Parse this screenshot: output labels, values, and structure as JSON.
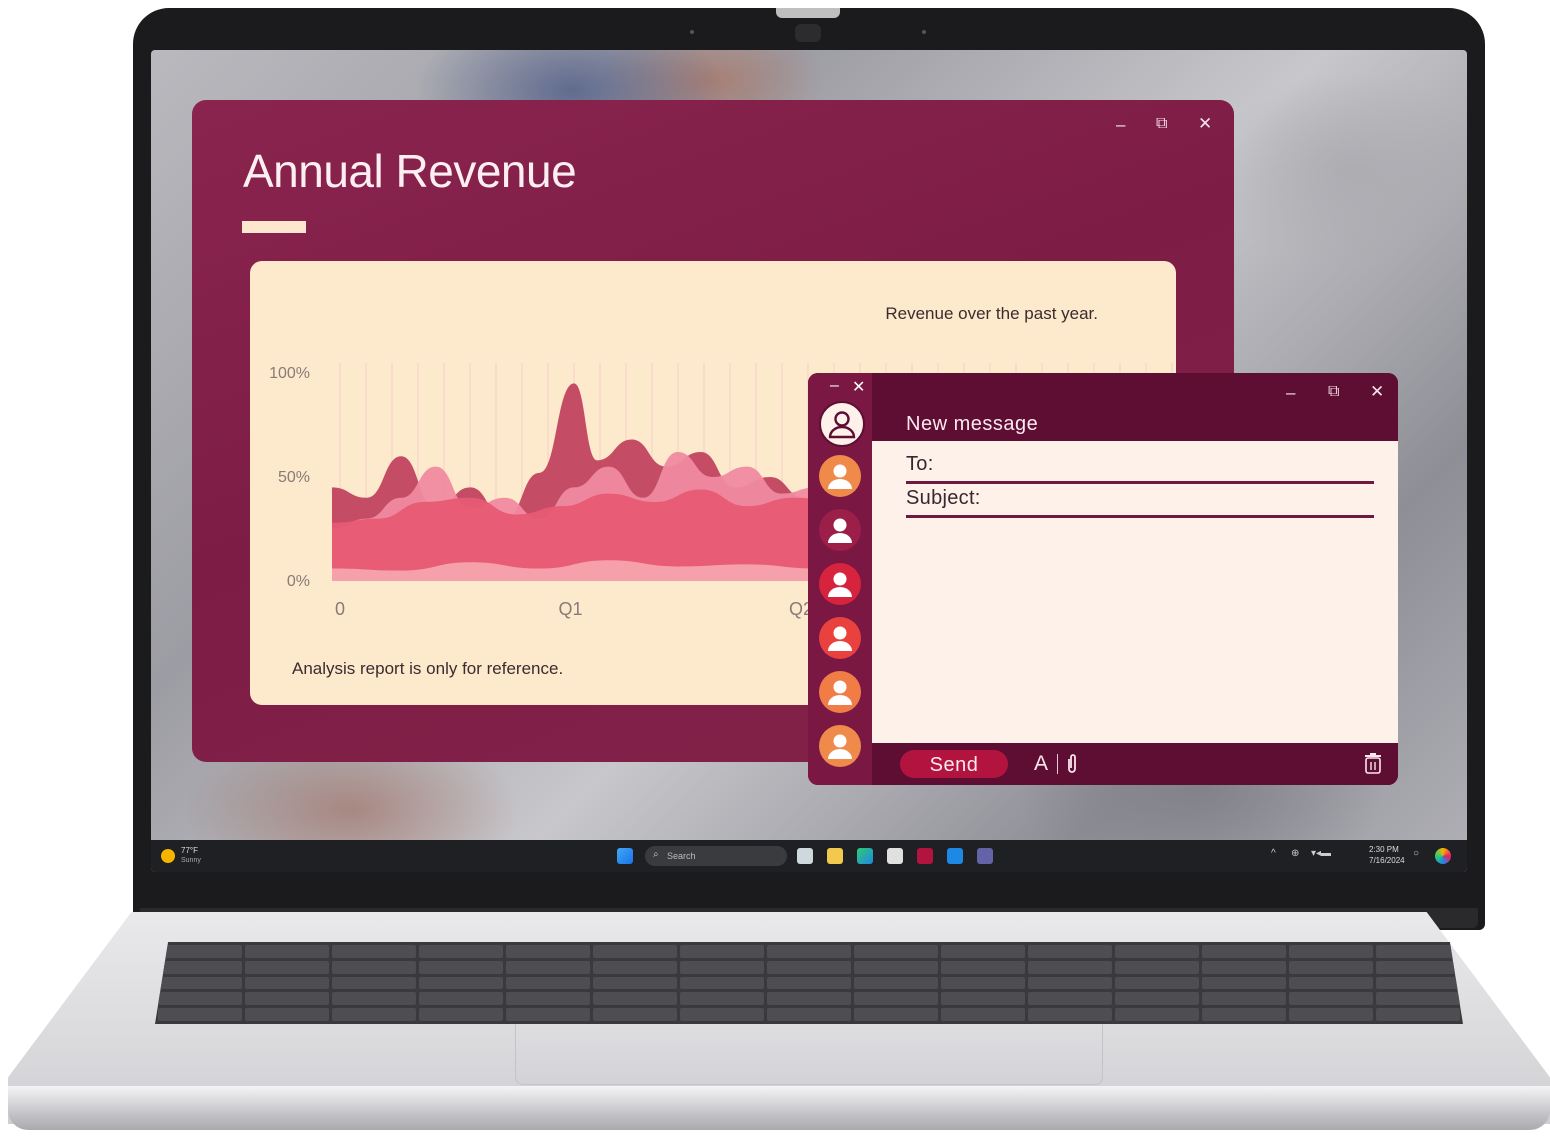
{
  "revenue_window": {
    "title": "Annual Revenue",
    "controls": {
      "minimize": "–",
      "maximize": "⧉",
      "close": "✕"
    }
  },
  "chart_data": {
    "type": "area",
    "title": "Revenue over the past year.",
    "footnote": "Analysis report is only for reference.",
    "yticks": [
      "100%",
      "50%",
      "0%"
    ],
    "xticks": [
      "0",
      "Q1",
      "Q2"
    ],
    "ylim": [
      0,
      100
    ],
    "xlim": [
      0,
      4
    ],
    "grid": true,
    "series": [
      {
        "color": "#c1455f",
        "x": [
          0,
          0.15,
          0.3,
          0.45,
          0.6,
          0.75,
          0.9,
          1.05,
          1.15,
          1.3,
          1.45,
          1.6,
          1.75,
          1.9,
          2.05,
          2.2
        ],
        "values": [
          45,
          40,
          60,
          35,
          45,
          30,
          52,
          95,
          58,
          68,
          55,
          62,
          45,
          50,
          40,
          48
        ]
      },
      {
        "color": "#f08aa0",
        "x": [
          0,
          0.15,
          0.3,
          0.45,
          0.6,
          0.75,
          0.9,
          1.05,
          1.2,
          1.35,
          1.5,
          1.65,
          1.8,
          1.95,
          2.1,
          2.2
        ],
        "values": [
          25,
          30,
          40,
          55,
          35,
          40,
          30,
          45,
          55,
          40,
          62,
          50,
          55,
          42,
          45,
          40
        ]
      },
      {
        "color": "#e85a73",
        "x": [
          0,
          0.2,
          0.4,
          0.6,
          0.8,
          1.0,
          1.2,
          1.4,
          1.6,
          1.8,
          2.0,
          2.2
        ],
        "values": [
          28,
          30,
          38,
          40,
          32,
          36,
          42,
          38,
          44,
          36,
          40,
          38
        ]
      },
      {
        "color": "#f7a3ae",
        "x": [
          0,
          0.3,
          0.6,
          0.9,
          1.2,
          1.5,
          1.8,
          2.1,
          2.2
        ],
        "values": [
          6,
          5,
          9,
          6,
          10,
          7,
          8,
          6,
          6
        ]
      }
    ]
  },
  "mail_window": {
    "title": "New message",
    "to_label": "To:",
    "subject_label": "Subject:",
    "to_value": "",
    "subject_value": "",
    "send_label": "Send",
    "format_label": "A",
    "mini_controls": {
      "minimize": "–",
      "close": "✕"
    },
    "controls": {
      "minimize": "–",
      "maximize": "⧉",
      "close": "✕"
    },
    "contacts": [
      {
        "name": "self",
        "color": "#fdf1ea"
      },
      {
        "name": "contact-1",
        "color": "#f08a4b"
      },
      {
        "name": "contact-2",
        "color": "#9c1f4a"
      },
      {
        "name": "contact-3",
        "color": "#d6243e"
      },
      {
        "name": "contact-4",
        "color": "#e8413e"
      },
      {
        "name": "contact-5",
        "color": "#f07d45"
      },
      {
        "name": "contact-6",
        "color": "#f08a4b"
      }
    ]
  },
  "taskbar": {
    "weather_temp": "77°F",
    "weather_desc": "Sunny",
    "search_placeholder": "Search",
    "time": "2:30 PM",
    "date": "7/16/2024"
  }
}
